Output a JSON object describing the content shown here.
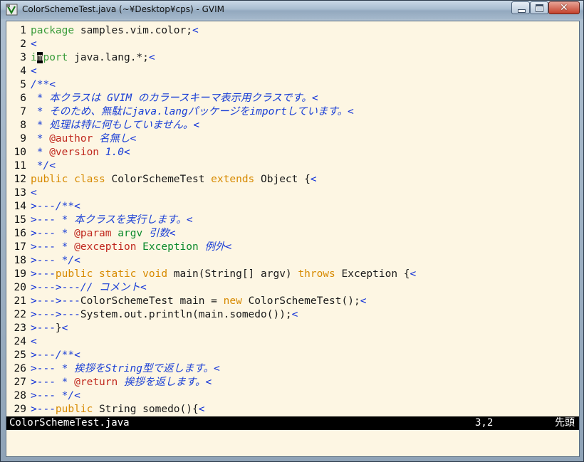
{
  "window": {
    "title": "ColorSchemeTest.java (~¥Desktop¥cps) - GVIM"
  },
  "colors": {
    "background": "#fdf6e3",
    "keyword": "#d78a00",
    "comment": "#1a3fd6",
    "tag": "#c0281e",
    "type": "#0b8a2c",
    "special": "#1030d8"
  },
  "editor": {
    "lines": [
      {
        "n": "1",
        "spans": [
          {
            "c": "pkg",
            "t": "package"
          },
          {
            "c": "normal",
            "t": " samples.vim.color;"
          },
          {
            "c": "special",
            "t": "<"
          }
        ]
      },
      {
        "n": "2",
        "spans": [
          {
            "c": "special",
            "t": "<"
          }
        ]
      },
      {
        "n": "3",
        "spans": [
          {
            "c": "pkg",
            "t": "i"
          },
          {
            "c": "cursor",
            "t": "m"
          },
          {
            "c": "pkg",
            "t": "port"
          },
          {
            "c": "normal",
            "t": " java.lang.*;"
          },
          {
            "c": "special",
            "t": "<"
          }
        ]
      },
      {
        "n": "4",
        "spans": [
          {
            "c": "special",
            "t": "<"
          }
        ]
      },
      {
        "n": "5",
        "spans": [
          {
            "c": "comment",
            "t": "/**"
          },
          {
            "c": "special",
            "t": "<"
          }
        ]
      },
      {
        "n": "6",
        "spans": [
          {
            "c": "comment",
            "t": " * 本クラスは GVIM のカラースキーマ表示用クラスです。"
          },
          {
            "c": "special",
            "t": "<"
          }
        ]
      },
      {
        "n": "7",
        "spans": [
          {
            "c": "comment",
            "t": " * そのため、無駄にjava.langパッケージをimportしています。"
          },
          {
            "c": "special",
            "t": "<"
          }
        ]
      },
      {
        "n": "8",
        "spans": [
          {
            "c": "comment",
            "t": " * 処理は特に何もしていません。"
          },
          {
            "c": "special",
            "t": "<"
          }
        ]
      },
      {
        "n": "9",
        "spans": [
          {
            "c": "comment",
            "t": " * "
          },
          {
            "c": "tag",
            "t": "@author"
          },
          {
            "c": "comment",
            "t": " 名無し"
          },
          {
            "c": "special",
            "t": "<"
          }
        ]
      },
      {
        "n": "10",
        "spans": [
          {
            "c": "comment",
            "t": " * "
          },
          {
            "c": "tag",
            "t": "@version"
          },
          {
            "c": "comment",
            "t": " 1.0"
          },
          {
            "c": "special",
            "t": "<"
          }
        ]
      },
      {
        "n": "11",
        "spans": [
          {
            "c": "comment",
            "t": " */"
          },
          {
            "c": "special",
            "t": "<"
          }
        ]
      },
      {
        "n": "12",
        "spans": [
          {
            "c": "keyword",
            "t": "public class"
          },
          {
            "c": "normal",
            "t": " ColorSchemeTest "
          },
          {
            "c": "keyword",
            "t": "extends"
          },
          {
            "c": "normal",
            "t": " Object {"
          },
          {
            "c": "special",
            "t": "<"
          }
        ]
      },
      {
        "n": "13",
        "spans": [
          {
            "c": "special",
            "t": "<"
          }
        ]
      },
      {
        "n": "14",
        "spans": [
          {
            "c": "indent",
            "t": ">---"
          },
          {
            "c": "comment",
            "t": "/**"
          },
          {
            "c": "special",
            "t": "<"
          }
        ]
      },
      {
        "n": "15",
        "spans": [
          {
            "c": "indent",
            "t": ">---"
          },
          {
            "c": "comment",
            "t": " * 本クラスを実行します。"
          },
          {
            "c": "special",
            "t": "<"
          }
        ]
      },
      {
        "n": "16",
        "spans": [
          {
            "c": "indent",
            "t": ">---"
          },
          {
            "c": "comment",
            "t": " * "
          },
          {
            "c": "tag",
            "t": "@param"
          },
          {
            "c": "normal",
            "t": " "
          },
          {
            "c": "type",
            "t": "argv"
          },
          {
            "c": "comment",
            "t": " 引数"
          },
          {
            "c": "special",
            "t": "<"
          }
        ]
      },
      {
        "n": "17",
        "spans": [
          {
            "c": "indent",
            "t": ">---"
          },
          {
            "c": "comment",
            "t": " * "
          },
          {
            "c": "tag",
            "t": "@exception"
          },
          {
            "c": "normal",
            "t": " "
          },
          {
            "c": "type",
            "t": "Exception"
          },
          {
            "c": "comment",
            "t": " 例外"
          },
          {
            "c": "special",
            "t": "<"
          }
        ]
      },
      {
        "n": "18",
        "spans": [
          {
            "c": "indent",
            "t": ">---"
          },
          {
            "c": "comment",
            "t": " */"
          },
          {
            "c": "special",
            "t": "<"
          }
        ]
      },
      {
        "n": "19",
        "spans": [
          {
            "c": "indent",
            "t": ">---"
          },
          {
            "c": "keyword",
            "t": "public static void"
          },
          {
            "c": "normal",
            "t": " main(String[] argv) "
          },
          {
            "c": "keyword",
            "t": "throws"
          },
          {
            "c": "normal",
            "t": " Exception {"
          },
          {
            "c": "special",
            "t": "<"
          }
        ]
      },
      {
        "n": "20",
        "spans": [
          {
            "c": "indent",
            "t": ">--->---"
          },
          {
            "c": "comment",
            "t": "// コメント"
          },
          {
            "c": "special",
            "t": "<"
          }
        ]
      },
      {
        "n": "21",
        "spans": [
          {
            "c": "indent",
            "t": ">--->---"
          },
          {
            "c": "normal",
            "t": "ColorSchemeTest main = "
          },
          {
            "c": "keyword",
            "t": "new"
          },
          {
            "c": "normal",
            "t": " ColorSchemeTest();"
          },
          {
            "c": "special",
            "t": "<"
          }
        ]
      },
      {
        "n": "22",
        "spans": [
          {
            "c": "indent",
            "t": ">--->---"
          },
          {
            "c": "normal",
            "t": "System.out.println(main.somedo());"
          },
          {
            "c": "special",
            "t": "<"
          }
        ]
      },
      {
        "n": "23",
        "spans": [
          {
            "c": "indent",
            "t": ">---"
          },
          {
            "c": "normal",
            "t": "}"
          },
          {
            "c": "special",
            "t": "<"
          }
        ]
      },
      {
        "n": "24",
        "spans": [
          {
            "c": "special",
            "t": "<"
          }
        ]
      },
      {
        "n": "25",
        "spans": [
          {
            "c": "indent",
            "t": ">---"
          },
          {
            "c": "comment",
            "t": "/**"
          },
          {
            "c": "special",
            "t": "<"
          }
        ]
      },
      {
        "n": "26",
        "spans": [
          {
            "c": "indent",
            "t": ">---"
          },
          {
            "c": "comment",
            "t": " * 挨拶をString型で返します。"
          },
          {
            "c": "special",
            "t": "<"
          }
        ]
      },
      {
        "n": "27",
        "spans": [
          {
            "c": "indent",
            "t": ">---"
          },
          {
            "c": "comment",
            "t": " * "
          },
          {
            "c": "tag",
            "t": "@return"
          },
          {
            "c": "comment",
            "t": " 挨拶を返します。"
          },
          {
            "c": "special",
            "t": "<"
          }
        ]
      },
      {
        "n": "28",
        "spans": [
          {
            "c": "indent",
            "t": ">---"
          },
          {
            "c": "comment",
            "t": " */"
          },
          {
            "c": "special",
            "t": "<"
          }
        ]
      },
      {
        "n": "29",
        "spans": [
          {
            "c": "indent",
            "t": ">---"
          },
          {
            "c": "keyword",
            "t": "public"
          },
          {
            "c": "normal",
            "t": " String somedo(){"
          },
          {
            "c": "special",
            "t": "<"
          }
        ]
      }
    ]
  },
  "statusline": {
    "filename": "ColorSchemeTest.java",
    "position": "3,2",
    "scroll": "先頭"
  }
}
